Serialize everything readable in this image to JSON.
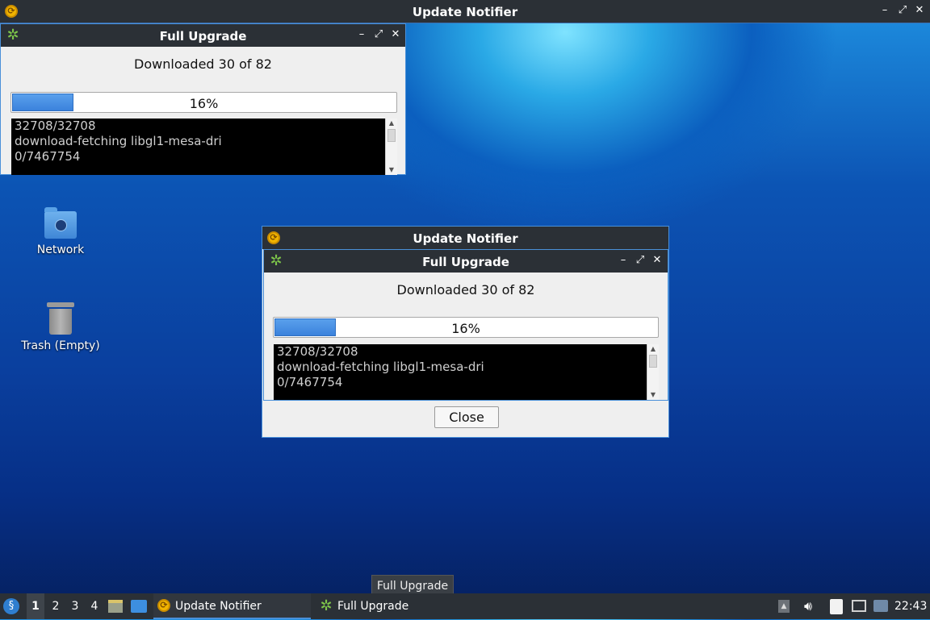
{
  "top_window": {
    "title": "Update Notifier"
  },
  "window_controls": {
    "minimize": "–",
    "maximize": "⤢",
    "close": "✕"
  },
  "dialog_back": {
    "title": "Full Upgrade",
    "status": "Downloaded 30 of 82",
    "progress_text": "16%",
    "progress_fraction": 0.16,
    "log_lines": [
      "32708/32708",
      "download-fetching libgl1-mesa-dri",
      "0/7467754"
    ]
  },
  "dialog_front_outer": {
    "title": "Update Notifier"
  },
  "dialog_front": {
    "title": "Full Upgrade",
    "status": "Downloaded 30 of 82",
    "progress_text": "16%",
    "progress_fraction": 0.16,
    "log_lines": [
      "32708/32708",
      "download-fetching libgl1-mesa-dri",
      "0/7467754"
    ],
    "close_label": "Close"
  },
  "desktop": {
    "icons": [
      {
        "label": "Network",
        "icon": "network-folder-icon"
      },
      {
        "label": "Trash (Empty)",
        "icon": "trash-icon"
      }
    ]
  },
  "taskbar": {
    "workspaces": [
      "1",
      "2",
      "3",
      "4"
    ],
    "tasks": [
      {
        "label": "Update Notifier",
        "icon": "update-notifier-icon"
      },
      {
        "label": "Full Upgrade",
        "icon": "gear-icon"
      }
    ],
    "clock": "22:43",
    "tooltip": "Full Upgrade"
  },
  "colors": {
    "accent": "#4a90d9",
    "titlebar": "#2b3036",
    "progress": "#3b82dc"
  }
}
